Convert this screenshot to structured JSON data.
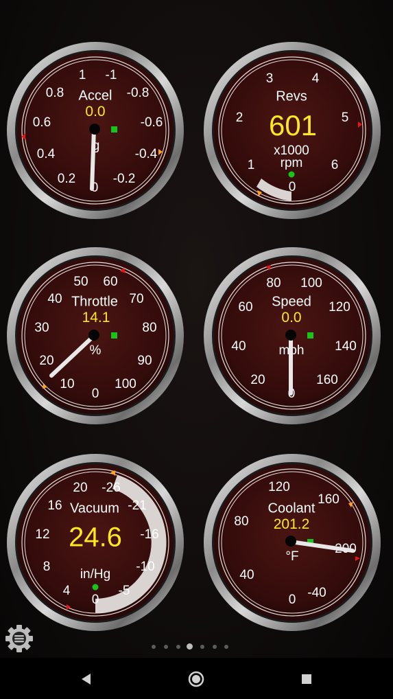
{
  "gauges": {
    "accel": {
      "title": "Accel",
      "value": "0.0",
      "unit": "g",
      "ticks": [
        "1",
        "-1",
        "0.8",
        "-0.8",
        "0.6",
        "-0.6",
        "0.4",
        "-0.4",
        "0.2",
        "-0.2",
        "0"
      ],
      "needle_fraction": 0.5,
      "status_color": "#18c418"
    },
    "revs": {
      "title": "Revs",
      "value": "601",
      "unit_line1": "x1000",
      "unit_line2": "rpm",
      "ticks": [
        "3",
        "4",
        "2",
        "5",
        "1",
        "6",
        "0"
      ],
      "needle_value": 0.601,
      "status_color": "#18c418"
    },
    "throttle": {
      "title": "Throttle",
      "value": "14.1",
      "unit": "%",
      "ticks": [
        "50",
        "60",
        "40",
        "70",
        "30",
        "80",
        "20",
        "90",
        "10",
        "100",
        "0"
      ],
      "needle_value": 14.1,
      "status_color": "#18c418"
    },
    "speed": {
      "title": "Speed",
      "value": "0.0",
      "unit": "mph",
      "ticks": [
        "80",
        "100",
        "60",
        "120",
        "40",
        "140",
        "20",
        "160",
        "0"
      ],
      "needle_value": 0.0,
      "status_color": "#18c418"
    },
    "vacuum": {
      "title": "Vacuum",
      "value": "24.6",
      "unit": "in/Hg",
      "ticks": [
        "20",
        "-26",
        "16",
        "-21",
        "12",
        "-16",
        "8",
        "-10",
        "4",
        "-5",
        "0"
      ],
      "needle_value": 24.6,
      "status_color": "#18c418"
    },
    "coolant": {
      "title": "Coolant",
      "value": "201.2",
      "unit": "°F",
      "ticks": [
        "120",
        "160",
        "80",
        "200",
        "40",
        "0",
        "-40"
      ],
      "needle_value": 201.2,
      "status_color": "#18c418"
    }
  },
  "colors": {
    "dial_face": "#3a0f0e",
    "value_yellow": "#ffe81f",
    "marker_red": "#e01818",
    "marker_orange": "#ffa21a"
  },
  "icons": {
    "settings": "gear-icon",
    "back": "back-triangle-icon",
    "home": "home-circle-icon",
    "recents": "recents-square-icon"
  },
  "pager": {
    "count": 7,
    "active_index": 3
  }
}
